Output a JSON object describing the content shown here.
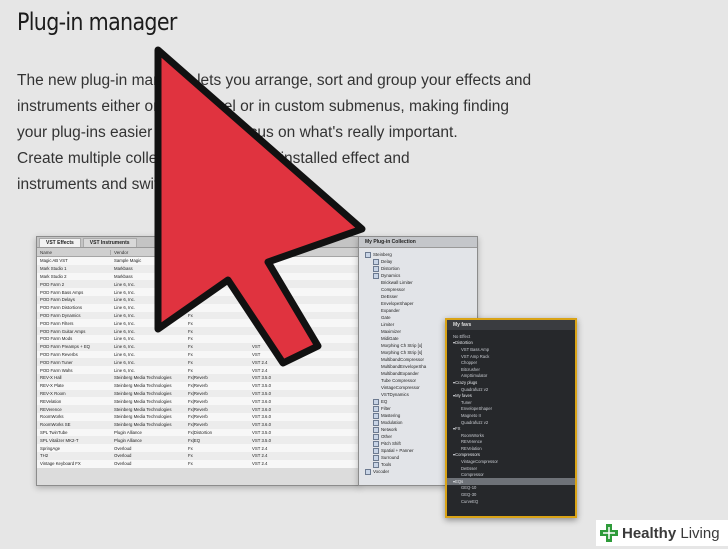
{
  "title": "Plug-in manager",
  "intro_lines": [
    "The new plug-in manager lets you arrange, sort and group your effects and",
    "instruments either on a flat level or in custom submenus, making finding",
    "your plug-ins easier so that you focus on what's really important.",
    "Create multiple collections / sets of all installed effect and",
    "instruments and switch between them!"
  ],
  "list_window": {
    "tabs": [
      "VST Effects",
      "VST Instruments"
    ],
    "columns": [
      "Name",
      "Vendor",
      "",
      "",
      "Instances"
    ],
    "rows": [
      [
        "Magic AB VST",
        "Sample Magic",
        "",
        ""
      ],
      [
        "Mark Studio 1",
        "Markbass",
        "",
        ""
      ],
      [
        "Mark Studio 2",
        "Markbass",
        "",
        ""
      ],
      [
        "POD Farm 2",
        "Line 6, Inc.",
        "",
        ""
      ],
      [
        "POD Farm Bass Amps",
        "Line 6, Inc.",
        "Fx",
        ""
      ],
      [
        "POD Farm Delays",
        "Line 6, Inc.",
        "Fx",
        ""
      ],
      [
        "POD Farm Distortions",
        "Line 6, Inc.",
        "Fx",
        ""
      ],
      [
        "POD Farm Dynamics",
        "Line 6, Inc.",
        "Fx",
        ""
      ],
      [
        "POD Farm Filters",
        "Line 6, Inc.",
        "Fx",
        ""
      ],
      [
        "POD Farm Guitar Amps",
        "Line 6, Inc.",
        "Fx",
        ""
      ],
      [
        "POD Farm Mods",
        "Line 6, Inc.",
        "Fx",
        ""
      ],
      [
        "POD Farm Preamps + EQ",
        "Line 6, Inc.",
        "Fx",
        "VST"
      ],
      [
        "POD Farm Reverbs",
        "Line 6, Inc.",
        "Fx",
        "VST"
      ],
      [
        "POD Farm Tuner",
        "Line 6, Inc.",
        "Fx",
        "VST 2.4"
      ],
      [
        "POD Farm Wahs",
        "Line 6, Inc.",
        "Fx",
        "VST 2.4"
      ],
      [
        "REV-X Hall",
        "Steinberg Media Technologies",
        "Fx|Reverb",
        "VST 3.5.0"
      ],
      [
        "REV-X Plate",
        "Steinberg Media Technologies",
        "Fx|Reverb",
        "VST 3.5.0"
      ],
      [
        "REV-X Room",
        "Steinberg Media Technologies",
        "Fx|Reverb",
        "VST 3.5.0"
      ],
      [
        "REVelation",
        "Steinberg Media Technologies",
        "Fx|Reverb",
        "VST 3.6.0"
      ],
      [
        "REVerence",
        "Steinberg Media Technologies",
        "Fx|Reverb",
        "VST 3.6.0"
      ],
      [
        "RoomWorks",
        "Steinberg Media Technologies",
        "Fx|Reverb",
        "VST 3.6.0"
      ],
      [
        "RoomWorks SE",
        "Steinberg Media Technologies",
        "Fx|Reverb",
        "VST 3.6.0"
      ],
      [
        "SPL TwinTube",
        "Plugin Alliance",
        "Fx|Distortion",
        "VST 3.5.0"
      ],
      [
        "SPL Vitalizer MK2-T",
        "Plugin Alliance",
        "Fx|EQ",
        "VST 3.5.0"
      ],
      [
        "SpringAge",
        "Overloud",
        "Fx",
        "VST 2.4"
      ],
      [
        "TH2",
        "Overloud",
        "Fx",
        "VST 2.4"
      ],
      [
        "Vintage Keyboard FX",
        "Overloud",
        "Fx",
        "VST 2.4"
      ]
    ]
  },
  "tree_window": {
    "title": "My Plug-in Collection",
    "items": [
      {
        "label": "Steinberg",
        "level": 0
      },
      {
        "label": "Delay",
        "level": 1
      },
      {
        "label": "Distortion",
        "level": 1
      },
      {
        "label": "Dynamics",
        "level": 1
      },
      {
        "label": "Brickwall Limiter",
        "level": 2
      },
      {
        "label": "Compressor",
        "level": 2
      },
      {
        "label": "DeEsser",
        "level": 2
      },
      {
        "label": "EnvelopeShaper",
        "level": 2
      },
      {
        "label": "Expander",
        "level": 2
      },
      {
        "label": "Gate",
        "level": 2
      },
      {
        "label": "Limiter",
        "level": 2
      },
      {
        "label": "Maximizer",
        "level": 2
      },
      {
        "label": "MidiGate",
        "level": 2
      },
      {
        "label": "Morphing Ch Strip [x]",
        "level": 2
      },
      {
        "label": "Morphing Ch Strip [s]",
        "level": 2
      },
      {
        "label": "MultibandCompressor",
        "level": 2
      },
      {
        "label": "MultibandEnvelopeSha",
        "level": 2
      },
      {
        "label": "MultibandExpander",
        "level": 2
      },
      {
        "label": "Tube Compressor",
        "level": 2
      },
      {
        "label": "VintageCompressor",
        "level": 2
      },
      {
        "label": "VSTDynamics",
        "level": 2
      },
      {
        "label": "EQ",
        "level": 1
      },
      {
        "label": "Filter",
        "level": 1
      },
      {
        "label": "Mastering",
        "level": 1
      },
      {
        "label": "Modulation",
        "level": 1
      },
      {
        "label": "Network",
        "level": 1
      },
      {
        "label": "Other",
        "level": 1
      },
      {
        "label": "Pitch Shift",
        "level": 1
      },
      {
        "label": "Spatial + Panner",
        "level": 1
      },
      {
        "label": "Surround",
        "level": 1
      },
      {
        "label": "Tools",
        "level": 1
      },
      {
        "label": "Vocoder",
        "level": 0
      }
    ]
  },
  "fav_window": {
    "title": "My favs",
    "items": [
      {
        "label": "No Effect",
        "level": 0,
        "group": false
      },
      {
        "label": "Distortion",
        "level": 0,
        "group": true
      },
      {
        "label": "VST Bass Amp",
        "level": 1,
        "group": false
      },
      {
        "label": "VST Amp Rack",
        "level": 1,
        "group": false
      },
      {
        "label": "Chopper",
        "level": 1,
        "group": false
      },
      {
        "label": "Bitcrusher",
        "level": 1,
        "group": false
      },
      {
        "label": "AmpSimulator",
        "level": 1,
        "group": false
      },
      {
        "label": "Crazy plugs",
        "level": 0,
        "group": true
      },
      {
        "label": "Quadrafuzz v2",
        "level": 1,
        "group": false
      },
      {
        "label": "My faves",
        "level": 0,
        "group": true
      },
      {
        "label": "Tuner",
        "level": 1,
        "group": false
      },
      {
        "label": "EnvelopeShaper",
        "level": 1,
        "group": false
      },
      {
        "label": "Magneto II",
        "level": 1,
        "group": false
      },
      {
        "label": "Quadrafuzz v2",
        "level": 1,
        "group": false
      },
      {
        "label": "FX",
        "level": 0,
        "group": true
      },
      {
        "label": "RoomWorks",
        "level": 1,
        "group": false
      },
      {
        "label": "REVerence",
        "level": 1,
        "group": false
      },
      {
        "label": "REVelation",
        "level": 1,
        "group": false
      },
      {
        "label": "Compressors",
        "level": 0,
        "group": true
      },
      {
        "label": "VintageCompressor",
        "level": 1,
        "group": false
      },
      {
        "label": "DeEsser",
        "level": 1,
        "group": false
      },
      {
        "label": "Compressor",
        "level": 1,
        "group": false
      },
      {
        "label": "EQs",
        "level": 0,
        "group": true,
        "selected": true
      },
      {
        "label": "GEQ-10",
        "level": 1,
        "group": false
      },
      {
        "label": "GEQ-30",
        "level": 1,
        "group": false
      },
      {
        "label": "CurveEQ",
        "level": 1,
        "group": false
      }
    ]
  },
  "watermark": {
    "bold": "Healthy",
    "light": " Living"
  },
  "colors": {
    "arrow_fill": "#e0333f",
    "arrow_stroke": "#111111",
    "fav_border": "#d9a316",
    "logo_green": "#2e9b3a"
  }
}
